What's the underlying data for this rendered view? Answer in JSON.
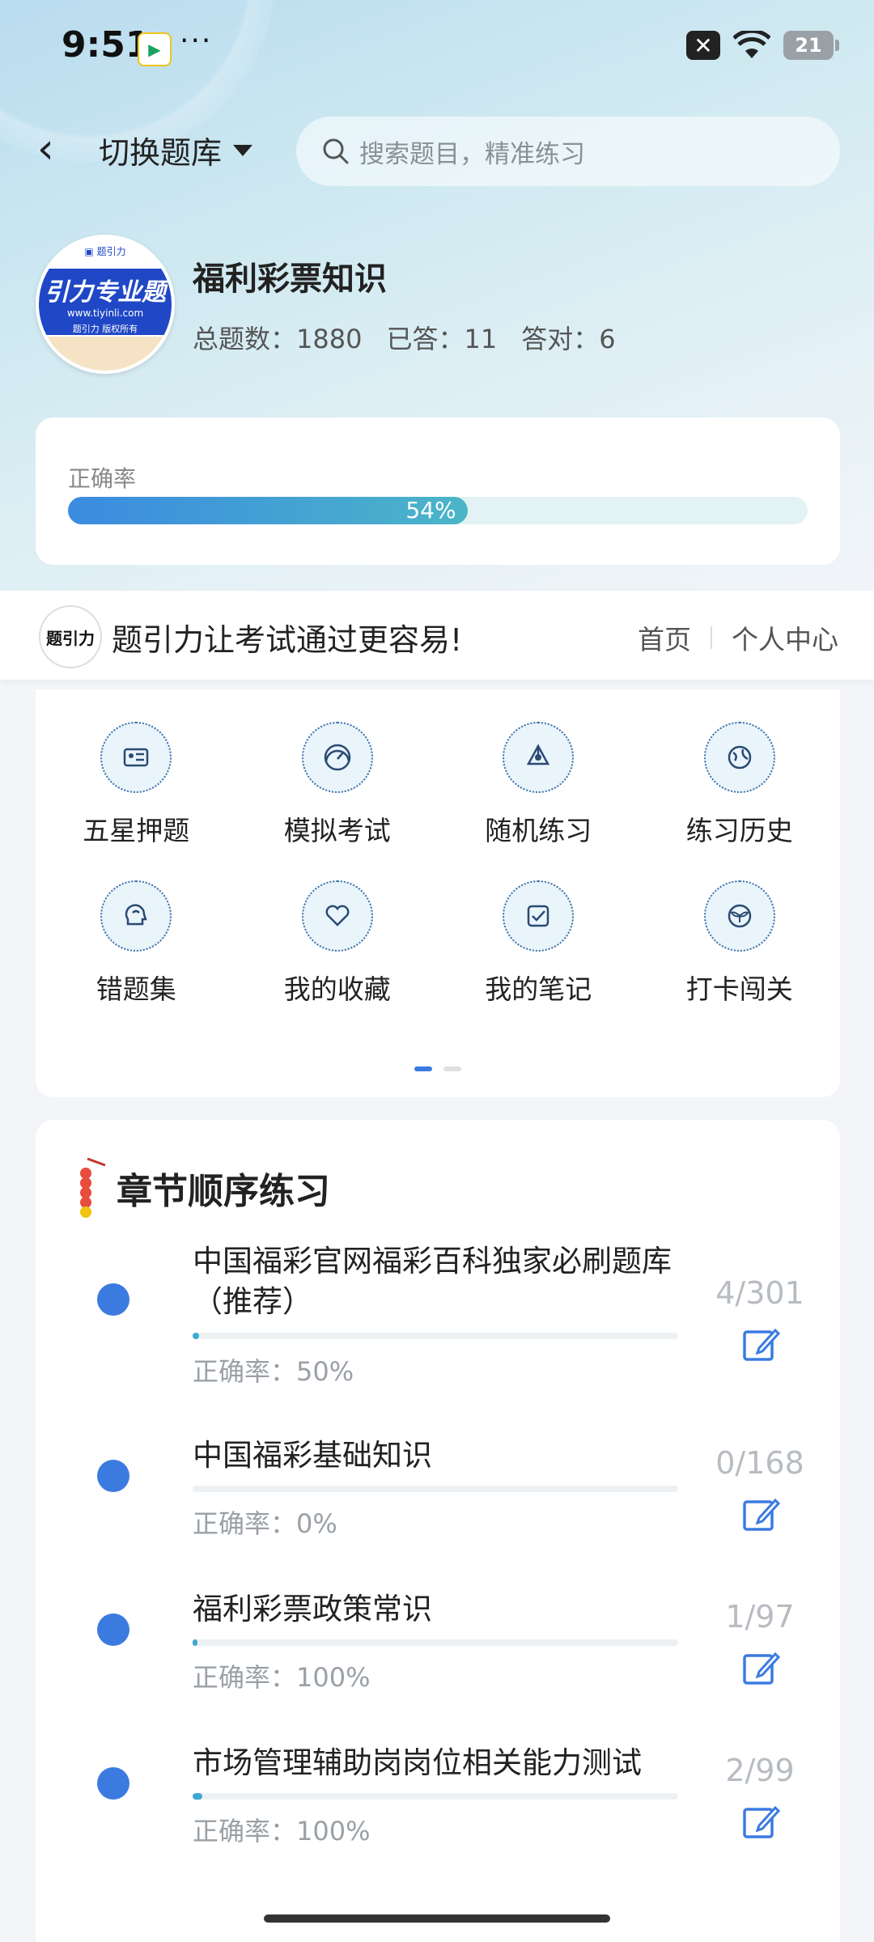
{
  "status_bar": {
    "time": "9:51",
    "battery": "21"
  },
  "nav": {
    "switch_label": "切换题库",
    "search_placeholder": "搜索题目，精准练习"
  },
  "bank": {
    "name": "福利彩票知识",
    "total_label": "总题数：1880",
    "answered_label": "已答：11",
    "correct_label": "答对：6",
    "logo": {
      "line1": "引力专业题",
      "url": "www.tiyinli.com",
      "sub": "题引力 版权所有"
    }
  },
  "accuracy": {
    "label": "正确率",
    "percent_text": "54%",
    "percent": 54
  },
  "banner": {
    "logo_text": "题引力",
    "slogan": "题引力让考试通过更容易!",
    "link_home": "首页",
    "link_profile": "个人中心"
  },
  "features": [
    {
      "label": "五星押题",
      "icon": "id-card-icon"
    },
    {
      "label": "模拟考试",
      "icon": "speedometer-icon"
    },
    {
      "label": "随机练习",
      "icon": "network-icon"
    },
    {
      "label": "练习历史",
      "icon": "globe-icon"
    },
    {
      "label": "错题集",
      "icon": "head-icon"
    },
    {
      "label": "我的收藏",
      "icon": "heart-icon"
    },
    {
      "label": "我的笔记",
      "icon": "checklist-icon"
    },
    {
      "label": "打卡闯关",
      "icon": "sprout-icon"
    }
  ],
  "chapters_section": {
    "title": "章节顺序练习",
    "items": [
      {
        "title": "中国福彩官网福彩百科独家必刷题库（推荐）",
        "rate": "正确率：50%",
        "count": "4/301",
        "progress": 0.0133
      },
      {
        "title": "中国福彩基础知识",
        "rate": "正确率：0%",
        "count": "0/168",
        "progress": 0
      },
      {
        "title": "福利彩票政策常识",
        "rate": "正确率：100%",
        "count": "1/97",
        "progress": 0.0103
      },
      {
        "title": "市场管理辅助岗岗位相关能力测试",
        "rate": "正确率：100%",
        "count": "2/99",
        "progress": 0.0202
      }
    ]
  },
  "colors": {
    "accent": "#3b7be0",
    "progress": "#3fa8d4",
    "muted_text": "#9aa0a6"
  }
}
